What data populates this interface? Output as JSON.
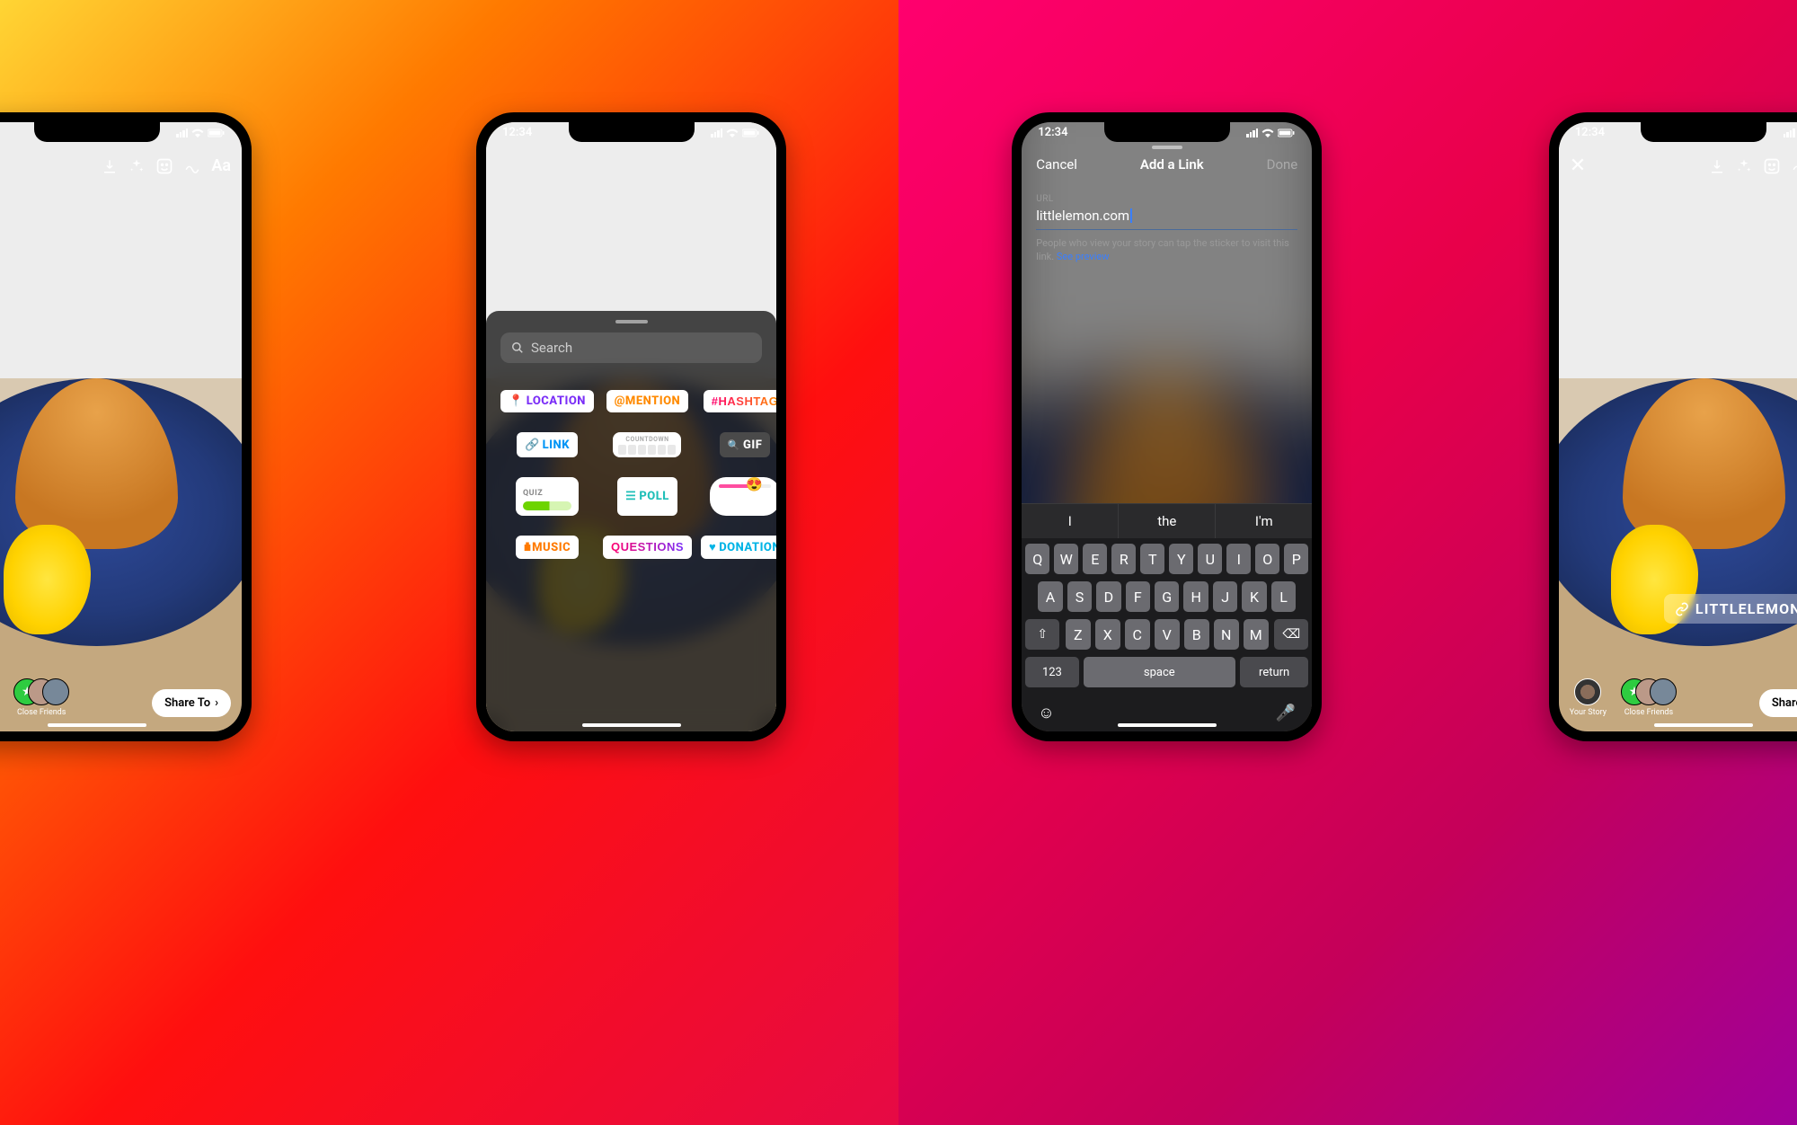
{
  "status": {
    "time": "12:34"
  },
  "editor": {
    "toolbar": {
      "text_tool": "Aa"
    },
    "targets": {
      "your_story": "Your Story",
      "close_friends": "Close Friends"
    },
    "share_button": "Share To"
  },
  "sticker_drawer": {
    "search_placeholder": "Search",
    "stickers": {
      "location": "LOCATION",
      "mention": "@MENTION",
      "hashtag": "#HASHTAG",
      "link": "LINK",
      "countdown": "COUNTDOWN",
      "gif": "GIF",
      "quiz": "QUIZ",
      "poll": "POLL",
      "music": "MUSIC",
      "questions": "QUESTIONS",
      "donation": "DONATION"
    }
  },
  "add_link": {
    "cancel": "Cancel",
    "title": "Add a Link",
    "done": "Done",
    "url_label": "URL",
    "url_value": "littlelemon.com",
    "help_text": "People who view your story can tap the sticker to visit this link. ",
    "see_preview": "See preview"
  },
  "keyboard": {
    "suggestions": [
      "I",
      "the",
      "I'm"
    ],
    "row1": [
      "Q",
      "W",
      "E",
      "R",
      "T",
      "Y",
      "U",
      "I",
      "O",
      "P"
    ],
    "row2": [
      "A",
      "S",
      "D",
      "F",
      "G",
      "H",
      "J",
      "K",
      "L"
    ],
    "row3": [
      "Z",
      "X",
      "C",
      "V",
      "B",
      "N",
      "M"
    ],
    "numkey": "123",
    "space": "space",
    "return": "return"
  },
  "link_sticker": {
    "text": "LITTLELEMON.COM"
  }
}
